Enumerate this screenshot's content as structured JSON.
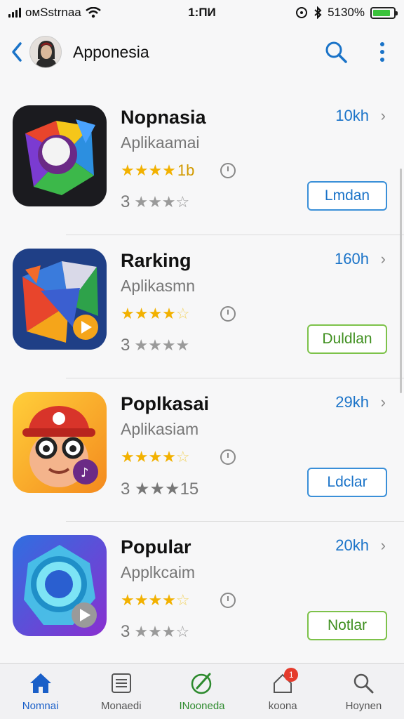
{
  "status": {
    "carrier": "oмSstrnaa",
    "time": "1:ПИ",
    "battery_pct": "5130%",
    "battery_level": 0.85
  },
  "header": {
    "title": "Apponesia"
  },
  "apps": [
    {
      "name": "Nopnasia",
      "subtitle": "Aplikaamai",
      "rating_label": "1b",
      "stars": 4,
      "count_label": "3",
      "size": "10kh",
      "button_label": "Lmdan",
      "button_style": "blue",
      "icon": "geometric-ball-app-icon"
    },
    {
      "name": "Rarking",
      "subtitle": "Aplikasmn",
      "rating_label": "",
      "stars": 4,
      "count_label": "3",
      "size": "160h",
      "button_label": "Duldlan",
      "button_style": "green",
      "icon": "geometric-play-app-icon"
    },
    {
      "name": "Poplkasai",
      "subtitle": "Aplikasiam",
      "rating_label": "",
      "stars": 4,
      "count_label": "3 ★★★15",
      "size": "29kh",
      "button_label": "Ldclar",
      "button_style": "blue",
      "icon": "cartoon-character-app-icon"
    },
    {
      "name": "Popular",
      "subtitle": "Applkcaim",
      "rating_label": "",
      "stars": 4,
      "count_label": "3",
      "size": "20kh",
      "button_label": "Notlar",
      "button_style": "green",
      "icon": "ring-app-icon"
    }
  ],
  "tabs": [
    {
      "label": "Nomnai",
      "icon": "home-icon",
      "state": "active"
    },
    {
      "label": "Monaedi",
      "icon": "list-icon",
      "state": ""
    },
    {
      "label": "INooneda",
      "icon": "compass-icon",
      "state": "green"
    },
    {
      "label": "koona",
      "icon": "house-badge-icon",
      "state": "",
      "badge": "1"
    },
    {
      "label": "Hoynen",
      "icon": "search-icon",
      "state": ""
    }
  ],
  "colors": {
    "accent": "#1a73c8",
    "star": "#f2b100",
    "green_button": "#7dc24a",
    "badge": "#e53b2c"
  }
}
